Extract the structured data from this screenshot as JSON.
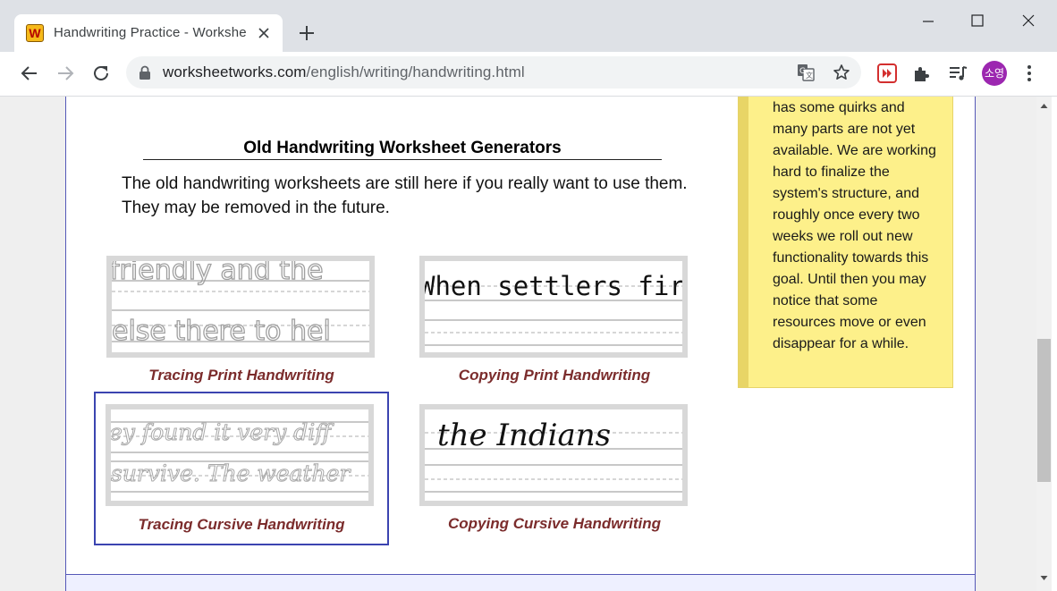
{
  "browser": {
    "tab_title": "Handwriting Practice - Workshe",
    "tab_favicon_letter": "W",
    "url_domain": "worksheetworks.com",
    "url_path": "/english/writing/handwriting.html",
    "profile_label": "소영"
  },
  "content": {
    "section_title": "Old Handwriting Worksheet Generators",
    "intro": "The old handwriting worksheets are still here if you really want to use them. They may be removed in the future.",
    "worksheets": [
      {
        "label": "Tracing Print Handwriting",
        "sample_top": "friendly and the",
        "sample_bottom": "else there to hel"
      },
      {
        "label": "Copying Print Handwriting",
        "sample_top": "When settlers first"
      },
      {
        "label": "Tracing Cursive Handwriting",
        "sample_top": "ey found it very diff",
        "sample_bottom": "survive. The weather",
        "selected": true
      },
      {
        "label": "Copying Cursive Handwriting",
        "sample_top": "the Indians"
      }
    ],
    "note_text": "has some quirks and many parts are not yet available. We are working hard to finalize the system's structure, and roughly once every two weeks we roll out new functionality towards this goal. Until then you may notice that some resources move or even disappear for a while."
  },
  "colors": {
    "link": "#7b2c2c",
    "note_bg": "#fdf08a",
    "selection_border": "#3b44b0",
    "page_border": "#5558b8"
  },
  "icons": [
    "close-icon",
    "plus-icon",
    "minimize-icon",
    "maximize-icon",
    "back-arrow-icon",
    "forward-arrow-icon",
    "reload-icon",
    "lock-icon",
    "translate-icon",
    "star-icon",
    "extension-icon",
    "puzzle-icon",
    "media-queue-icon",
    "kebab-menu-icon"
  ]
}
